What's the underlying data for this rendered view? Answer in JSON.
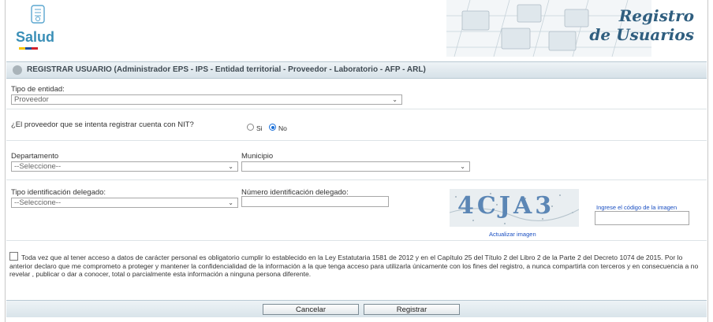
{
  "header": {
    "logo_text": "Salud",
    "brand_line1": "Registro",
    "brand_line2": "de Usuarios"
  },
  "form": {
    "title": "REGISTRAR USUARIO (Administrador EPS - IPS - Entidad territorial - Proveedor - Laboratorio - AFP - ARL)",
    "entity_type": {
      "label": "Tipo de entidad:",
      "value": "Proveedor"
    },
    "nit_question": {
      "label": "¿El proveedor que se intenta registrar cuenta con NIT?",
      "options": [
        {
          "label": "Si",
          "selected": false
        },
        {
          "label": "No",
          "selected": true
        }
      ]
    },
    "departamento": {
      "label": "Departamento",
      "value": "--Seleccione--"
    },
    "municipio": {
      "label": "Municipio",
      "value": ""
    },
    "tipo_id": {
      "label": "Tipo identificación delegado:",
      "value": "--Seleccione--"
    },
    "numero_id": {
      "label": "Número identificación delegado:",
      "value": ""
    },
    "captcha": {
      "code": "4CJA3",
      "refresh_label": "Actualizar imagen",
      "input_label": "Ingrese el código de la imagen",
      "input_value": ""
    },
    "consent_text": "Toda vez que al tener acceso a datos de carácter personal es obligatorio cumplir lo establecido en la Ley Estatutaria 1581 de 2012 y en el Capítulo 25 del Título 2 del Libro 2 de la Parte 2 del Decreto 1074 de 2015. Por lo anterior declaro que me comprometo a proteger y mantener la confidencialidad de la información a la que tenga acceso para utilizarla únicamente con los fines del registro, a nunca compartirla con terceros y en consecuencia a no revelar , publicar o dar a conocer, total o parcialmente esta información a ninguna persona diferente.",
    "consent_checked": false
  },
  "buttons": {
    "cancel": "Cancelar",
    "register": "Registrar"
  },
  "colors": {
    "brand": "#2f5e7f",
    "title_bg": "#d6e1e8",
    "link": "#1a4fc2",
    "radio": "#1a6fd9"
  }
}
